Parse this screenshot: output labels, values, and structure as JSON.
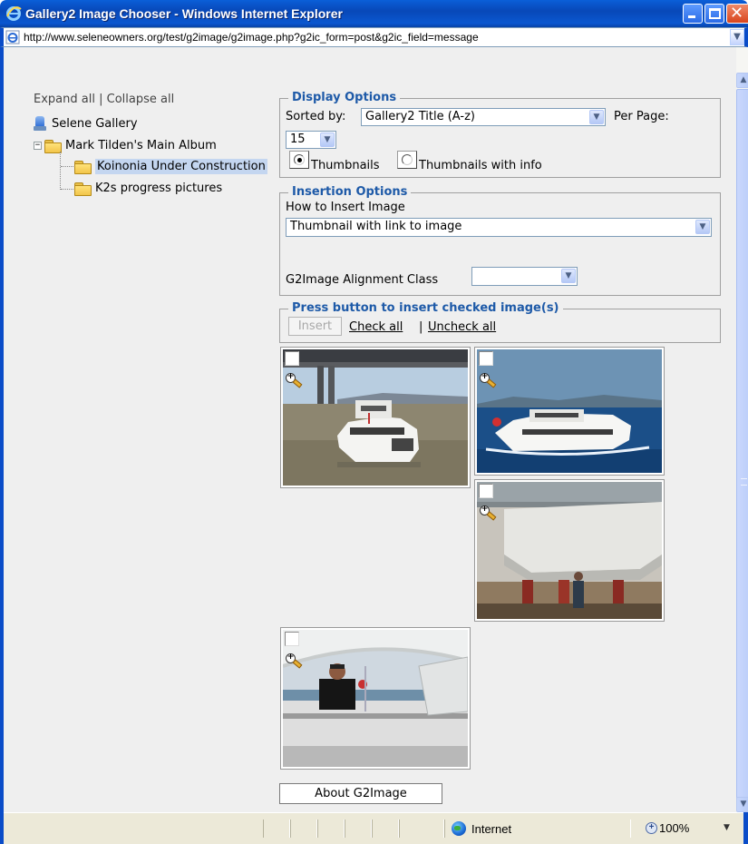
{
  "window": {
    "title": "Gallery2 Image Chooser - Windows Internet Explorer",
    "url": "http://www.seleneowners.org/test/g2image/g2image.php?g2ic_form=post&g2ic_field=message",
    "icon": "ie-icon"
  },
  "tree": {
    "expand_all": "Expand all",
    "separator": "|",
    "collapse_all": "Collapse all",
    "root": "Selene Gallery",
    "album": "Mark Tilden's Main Album",
    "album_toggle": "⊟",
    "children": [
      {
        "label": "Koinonia Under Construction",
        "selected": true
      },
      {
        "label": "K2s progress pictures",
        "selected": false
      }
    ]
  },
  "display_options": {
    "legend": "Display Options",
    "sorted_by_label": "Sorted by:",
    "sorted_by_value": "Gallery2 Title (A-z)",
    "per_page_label": "Per Page:",
    "per_page_value": "15",
    "radio_thumbnails": "Thumbnails",
    "radio_thumbnails_info": "Thumbnails with info",
    "selected_view": "Thumbnails"
  },
  "insertion_options": {
    "legend": "Insertion Options",
    "how_label": "How to Insert Image",
    "how_value": "Thumbnail with link to image",
    "alignment_label": "G2Image Alignment Class",
    "alignment_value": ""
  },
  "insert_section": {
    "legend": "Press button to insert checked image(s)",
    "insert_button": "Insert",
    "check_all": "Check all",
    "uncheck_all": "Uncheck all",
    "separator": "|"
  },
  "thumbnails": [
    {
      "name": "boat-under-bridge",
      "checked": false
    },
    {
      "name": "boat-on-water",
      "checked": false
    },
    {
      "name": "hull-in-shipyard",
      "checked": false
    },
    {
      "name": "man-on-flybridge",
      "checked": false
    }
  ],
  "about_button": "About G2Image",
  "statusbar": {
    "zone": "Internet",
    "zoom": "100%"
  },
  "colors": {
    "titlebar": "#0a57d0",
    "legend": "#1e5aa8",
    "background": "#efefef"
  }
}
